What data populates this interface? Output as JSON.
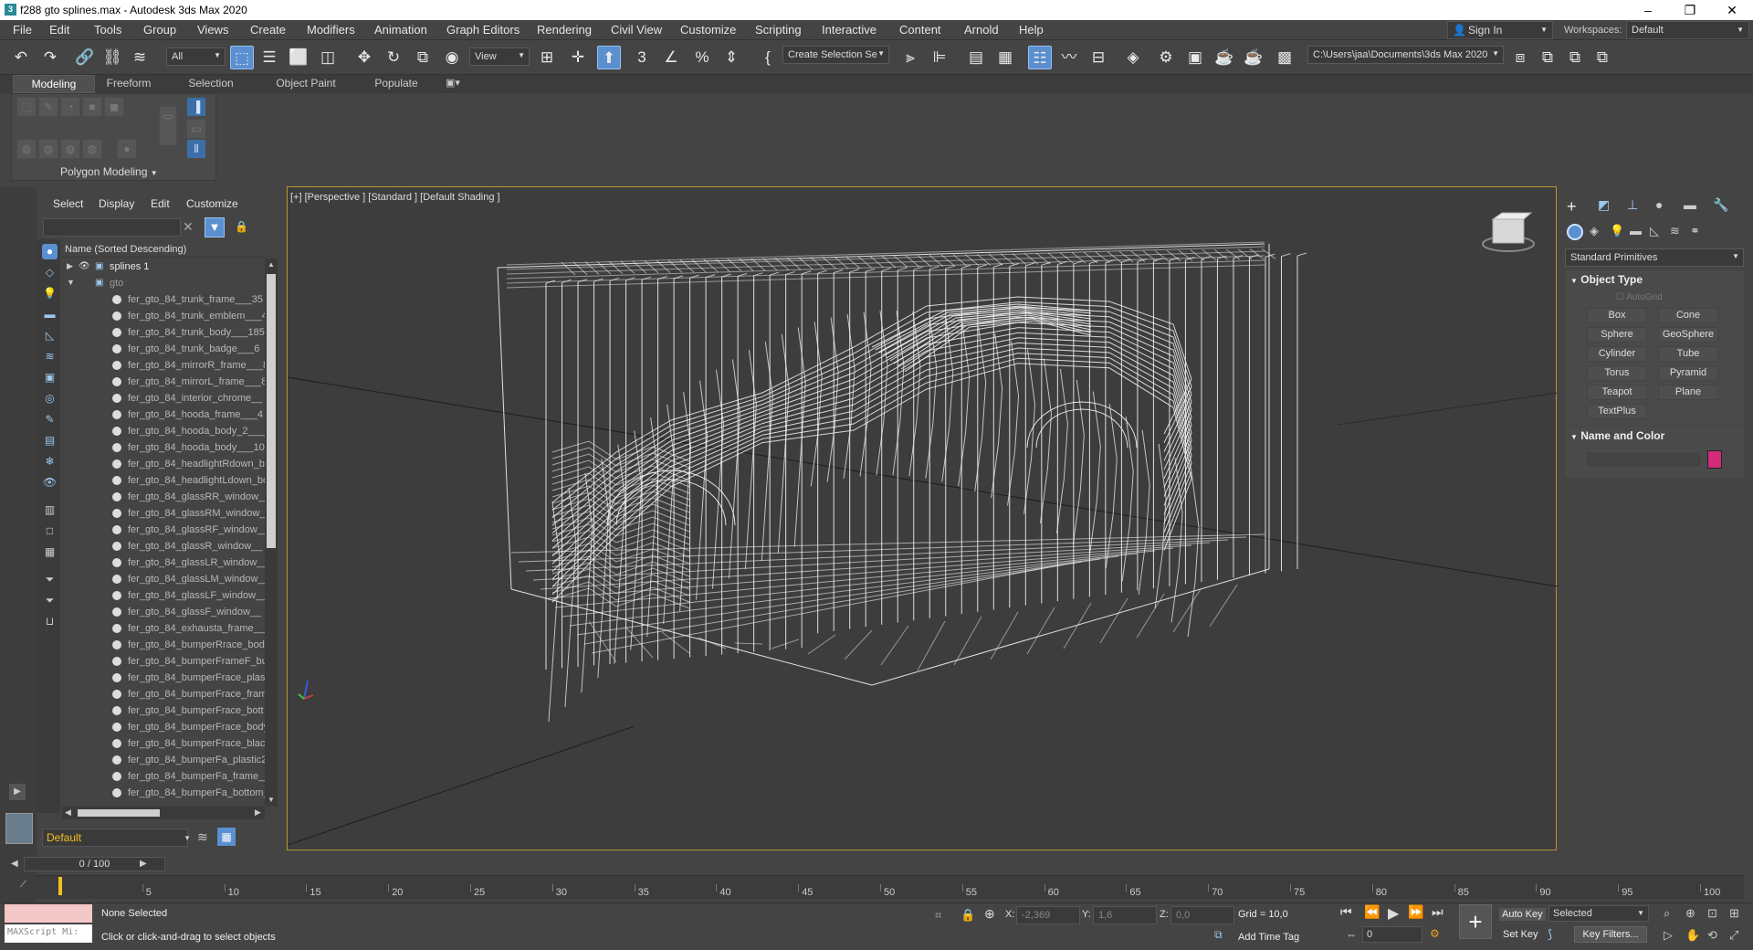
{
  "window": {
    "title": "f288 gto splines.max - Autodesk 3ds Max 2020",
    "app_icon": "3ds-max-icon",
    "minimize": "–",
    "restore": "❐",
    "close": "✕"
  },
  "menu": [
    "File",
    "Edit",
    "Tools",
    "Group",
    "Views",
    "Create",
    "Modifiers",
    "Animation",
    "Graph Editors",
    "Rendering",
    "Civil View",
    "Customize",
    "Scripting",
    "Interactive",
    "Content",
    "Arnold",
    "Help"
  ],
  "account": {
    "signin": "Sign In",
    "workspace_label": "Workspaces:",
    "workspace_value": "Default"
  },
  "toolbar": {
    "filter_value": "All",
    "view_value": "View",
    "selection_set": "Create Selection Se",
    "path": "C:\\Users\\jaa\\Documents\\3ds Max 2020"
  },
  "ribbon": {
    "tabs": [
      "Modeling",
      "Freeform",
      "Selection",
      "Object Paint",
      "Populate"
    ],
    "active_tab": "Modeling",
    "panel_label": "Polygon Modeling"
  },
  "scene_explorer": {
    "tabs": [
      "Select",
      "Display",
      "Edit",
      "Customize"
    ],
    "column_header": "Name (Sorted Descending)",
    "groups": [
      {
        "name": "splines 1",
        "expanded": false
      },
      {
        "name": "gto",
        "expanded": true
      }
    ],
    "items": [
      "fer_gto_84_trunk_frame___35",
      "fer_gto_84_trunk_emblem___4",
      "fer_gto_84_trunk_body___185",
      "fer_gto_84_trunk_badge___6",
      "fer_gto_84_mirrorR_frame___8",
      "fer_gto_84_mirrorL_frame___8",
      "fer_gto_84_interior_chrome__",
      "fer_gto_84_hooda_frame___4",
      "fer_gto_84_hooda_body_2___",
      "fer_gto_84_hooda_body___10",
      "fer_gto_84_headlightRdown_bo",
      "fer_gto_84_headlightLdown_bo",
      "fer_gto_84_glassRR_window__",
      "fer_gto_84_glassRM_window__",
      "fer_gto_84_glassRF_window__",
      "fer_gto_84_glassR_window__",
      "fer_gto_84_glassLR_window__",
      "fer_gto_84_glassLM_window__",
      "fer_gto_84_glassLF_window__",
      "fer_gto_84_glassF_window__",
      "fer_gto_84_exhausta_frame__",
      "fer_gto_84_bumperRrace_body",
      "fer_gto_84_bumperFrameF_bu",
      "fer_gto_84_bumperFrace_plast",
      "fer_gto_84_bumperFrace_fram",
      "fer_gto_84_bumperFrace_bott",
      "fer_gto_84_bumperFrace_body",
      "fer_gto_84_bumperFrace_black",
      "fer_gto_84_bumperFa_plastic2",
      "fer_gto_84_bumperFa_frame__",
      "fer_gto_84_bumperFa_bottom_"
    ],
    "layer": "Default"
  },
  "viewport": {
    "label": "[+] [Perspective ] [Standard ] [Default Shading ]"
  },
  "command_panel": {
    "category": "Standard Primitives",
    "object_type_title": "Object Type",
    "autogrid": "AutoGrid",
    "buttons": [
      "Box",
      "Cone",
      "Sphere",
      "GeoSphere",
      "Cylinder",
      "Tube",
      "Torus",
      "Pyramid",
      "Teapot",
      "Plane",
      "TextPlus"
    ],
    "name_color_title": "Name and Color",
    "color": "#d22b7a"
  },
  "timeline": {
    "slider": "0 / 100",
    "ticks": [
      "5",
      "10",
      "15",
      "20",
      "25",
      "30",
      "35",
      "40",
      "45",
      "50",
      "55",
      "60",
      "65",
      "70",
      "75",
      "80",
      "85",
      "90",
      "95",
      "100"
    ]
  },
  "status": {
    "selection": "None Selected",
    "prompt": "Click or click-and-drag to select objects",
    "maxscript": "MAXScript Mi:",
    "x_label": "X:",
    "x": "-2,369",
    "y_label": "Y:",
    "y": "1,6",
    "z_label": "Z:",
    "z": "0,0",
    "grid": "Grid = 10,0",
    "add_time_tag": "Add Time Tag",
    "auto_key": "Auto Key",
    "set_key": "Set Key",
    "key_mode": "Selected",
    "key_filters": "Key Filters...",
    "frame": "0"
  }
}
